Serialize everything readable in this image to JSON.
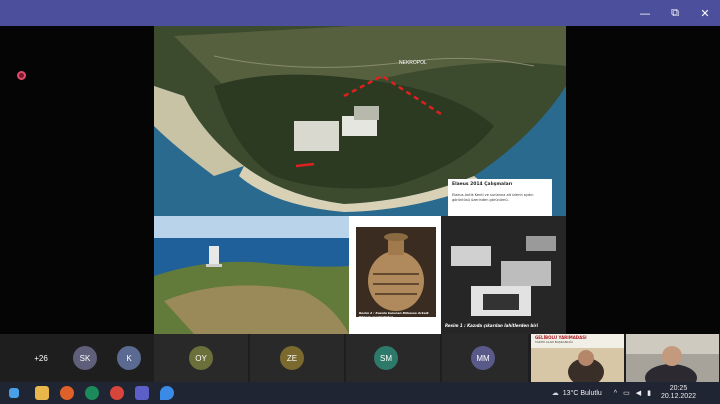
{
  "window": {
    "controls": [
      "—",
      "⧉",
      "✕"
    ]
  },
  "slide": {
    "necropolis_label": "NEKROPOL",
    "caption_title": "Elaeus 2014 Çalışmaları",
    "caption_text": "Elaeus Antik Kenti ve surlarına ait izlerin aydın görüntüsü üzerinden görünümü.",
    "excavation_caption": "Resim 1 : Kazıda çıkarılan lahitlerden biri",
    "vase_caption": "Resim 2 : Kazıda bulunan Bilhassa Arkaik Dönem eserlerinden"
  },
  "participants": [
    {
      "initials": "+26",
      "color": "#5b5fc7"
    },
    {
      "initials": "SK",
      "color": "#5f5f7a"
    },
    {
      "initials": "K",
      "color": "#5a6a90"
    },
    {
      "initials": "OY",
      "color": "#6b6f3a"
    },
    {
      "initials": "ZE",
      "color": "#7a6a2e"
    },
    {
      "initials": "SM",
      "color": "#2e7a6a"
    },
    {
      "initials": "MM",
      "color": "#5a5a8a"
    }
  ],
  "video_tiles": {
    "poster_line1": "GELİBOLU YARIMADASI",
    "poster_line2": "TARİHİ ALAN BAŞKANLIĞI"
  },
  "taskbar": {
    "weather": "13°C  Bulutlu",
    "time": "20:25",
    "date": "20.12.2022"
  }
}
